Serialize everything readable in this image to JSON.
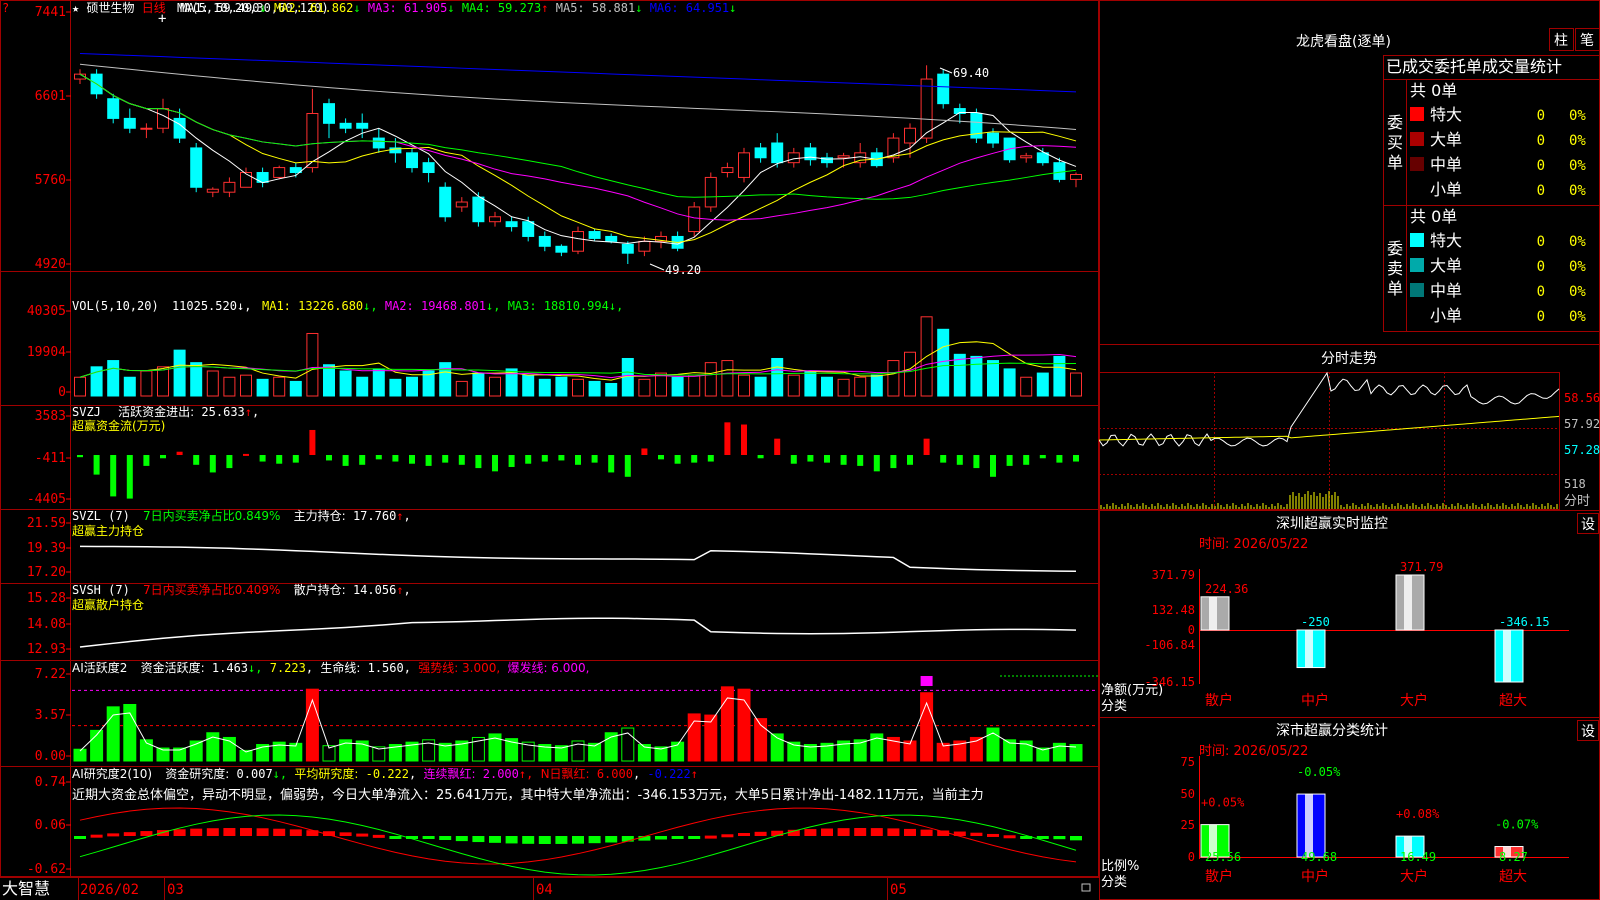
{
  "app": {
    "brand": "大智慧",
    "star": "★",
    "stock_name": "硕世生物",
    "period": "日线",
    "tag": "?"
  },
  "panels": {
    "main": {
      "ma_spec": "MA(5,10,20,30,60,120)",
      "ma": [
        {
          "name": "MA1:",
          "value": "59.490",
          "dir": "↓",
          "color": "#ffffff"
        },
        {
          "name": "MA2:",
          "value": "61.862",
          "dir": "↓",
          "color": "#ffff00"
        },
        {
          "name": "MA3:",
          "value": "61.905",
          "dir": "↓",
          "color": "#ff00ff"
        },
        {
          "name": "MA4:",
          "value": "59.273",
          "dir": "↑",
          "color": "#00ff00"
        },
        {
          "name": "MA5:",
          "value": "58.881",
          "dir": "↓",
          "color": "#c0c0c0"
        },
        {
          "name": "MA6:",
          "value": "64.951",
          "dir": "↓",
          "color": "#0000ff"
        }
      ],
      "yticks": [
        "7441",
        "6601",
        "5760",
        "4920"
      ],
      "hi_label": "69.40",
      "lo_label": "49.20"
    },
    "vol": {
      "spec": "VOL(5,10,20)",
      "value": "11025.520",
      "ma": [
        {
          "name": "MA1:",
          "value": "13226.680",
          "dir": "↓",
          "color": "#ffff00"
        },
        {
          "name": "MA2:",
          "value": "19468.801",
          "dir": "↓",
          "color": "#ff00ff"
        },
        {
          "name": "MA3:",
          "value": "18810.994",
          "dir": "↓",
          "color": "#00ff00"
        }
      ],
      "yticks": [
        "40305",
        "19904",
        "0"
      ]
    },
    "svzj": {
      "name": "SVZJ",
      "label": "活跃资金进出:",
      "value": "25.633",
      "dir": "↑",
      "sub": "超赢资金流(万元)",
      "yticks": [
        "3583",
        "-411",
        "-4405"
      ]
    },
    "svzl": {
      "name": "SVZL (7)",
      "label": "7日内买卖净占比0.849%",
      "label2": "主力持仓:",
      "value": "17.760",
      "dir": "↑",
      "sub": "超赢主力持仓",
      "yticks": [
        "21.59",
        "19.39",
        "17.20"
      ]
    },
    "svsh": {
      "name": "SVSH (7)",
      "label": "7日内买卖净占比0.409%",
      "label2": "散户持仓:",
      "value": "14.056",
      "dir": "↑",
      "sub": "超赢散户持仓",
      "yticks": [
        "15.28",
        "14.08",
        "12.93"
      ]
    },
    "ai1": {
      "name": "AI活跃度2",
      "label": "资金活跃度:",
      "v1": "1.463",
      "v2": "7.223",
      "label3": "生命线:",
      "v3": "1.560",
      "strong": "强势线: 3.000,",
      "burst": "爆发线: 6.000,",
      "yticks": [
        "7.22",
        "3.57",
        "0.00"
      ]
    },
    "ai2": {
      "name": "AI研究度2(10)",
      "label": "资金研究度:",
      "v1": "0.007",
      "label2": "平均研究度:",
      "v2": "-0.222",
      "label3": "连续飘红:",
      "v3": "2.000",
      "label4": "N日飘红:",
      "v4": "6.000",
      "v5": "-0.222",
      "text": "近期大资金总体偏空，异动不明显，偏弱势，今日大单净流入：25.641万元，其中特大单净流出：-346.153万元，大单5日累计净出-1482.11万元，当前主力",
      "yticks": [
        "0.74",
        "0.06",
        "-0.62"
      ]
    }
  },
  "xaxis": {
    "labels": [
      "2026/02",
      "03",
      "04",
      "05"
    ]
  },
  "right": {
    "lhb": {
      "title": "龙虎看盘(逐单)",
      "btn_zhu": "柱",
      "btn_bi": "笔",
      "header": "已成交委托单成交量统计",
      "buy_label": "委买单",
      "sell_label": "委卖单",
      "buy_total": "共 0单",
      "sell_total": "共 0单",
      "rows_buy": [
        {
          "name": "特大",
          "n": "0",
          "pct": "0%",
          "color": "#ff0000"
        },
        {
          "name": "大单",
          "n": "0",
          "pct": "0%",
          "color": "#aa0000"
        },
        {
          "name": "中单",
          "n": "0",
          "pct": "0%",
          "color": "#660000"
        },
        {
          "name": "小单",
          "n": "0",
          "pct": "0%",
          "color": "#000000"
        }
      ],
      "rows_sell": [
        {
          "name": "特大",
          "n": "0",
          "pct": "0%",
          "color": "#00ffff"
        },
        {
          "name": "大单",
          "n": "0",
          "pct": "0%",
          "color": "#00aaaa"
        },
        {
          "name": "中单",
          "n": "0",
          "pct": "0%",
          "color": "#007777"
        },
        {
          "name": "小单",
          "n": "0",
          "pct": "0%",
          "color": "#000000"
        }
      ]
    },
    "intraday": {
      "title": "分时走势",
      "yticks": [
        "58.56",
        "57.92",
        "57.28"
      ],
      "vol_tick": "518",
      "vol_unit": "分时"
    },
    "szmon": {
      "title": "深圳超赢实时监控",
      "setting": "设",
      "time": "时间: 2026/05/22",
      "ylabel": "净额(万元)",
      "xlabel": "分类",
      "yticks": [
        "371.79",
        "132.48",
        "0",
        "-106.84",
        "-346.15"
      ],
      "cats": [
        "散户",
        "中户",
        "大户",
        "超大"
      ],
      "values": [
        224.36,
        -250,
        371.79,
        -346.15
      ],
      "labels": [
        "224.36",
        "-250",
        "371.79",
        "-346.15"
      ]
    },
    "szcls": {
      "title": "深市超赢分类统计",
      "setting": "设",
      "time": "时间: 2026/05/22",
      "ylabel": "比例%",
      "xlabel": "分类",
      "yticks": [
        "75",
        "50",
        "25",
        "0"
      ],
      "cats": [
        "散户",
        "中户",
        "大户",
        "超大"
      ],
      "values": [
        25.56,
        49.68,
        16.49,
        8.27
      ],
      "chg": [
        "+0.05%",
        "-0.05%",
        "+0.08%",
        "-0.07%"
      ],
      "labels": [
        "25.56",
        "49.68",
        "16.49",
        "8.27"
      ]
    }
  },
  "chart_data": [
    {
      "type": "candlestick",
      "title": "硕世生物 日线",
      "ylim": [
        49.2,
        74.41
      ],
      "ohlc": [
        [
          68,
          69,
          67.5,
          68.5
        ],
        [
          68.5,
          69,
          66,
          66.5
        ],
        [
          66,
          66.5,
          63.5,
          64
        ],
        [
          64,
          65,
          62.5,
          63
        ],
        [
          63,
          63.5,
          62,
          63
        ],
        [
          63,
          66,
          62.5,
          65
        ],
        [
          64,
          65,
          61.5,
          62
        ],
        [
          61,
          61.5,
          56.5,
          57
        ],
        [
          56.5,
          57,
          56,
          56.8
        ],
        [
          56.5,
          58,
          56,
          57.5
        ],
        [
          57,
          59,
          57,
          58.5
        ],
        [
          58.5,
          59,
          57,
          57.5
        ],
        [
          58,
          59.2,
          57.8,
          59
        ],
        [
          59,
          59.5,
          58,
          58.5
        ],
        [
          59,
          67,
          58.5,
          64.5
        ],
        [
          65.5,
          66,
          62,
          63.5
        ],
        [
          63.5,
          64,
          62.5,
          63
        ],
        [
          63.5,
          64.5,
          62,
          63
        ],
        [
          62,
          63,
          60.5,
          61
        ],
        [
          61,
          62,
          59.5,
          60.5
        ],
        [
          60.5,
          61,
          58.5,
          59
        ],
        [
          59.5,
          60,
          57.5,
          58.5
        ],
        [
          57,
          57.5,
          53.5,
          54
        ],
        [
          55,
          56,
          54.5,
          55.5
        ],
        [
          56,
          56.5,
          53,
          53.5
        ],
        [
          53.5,
          54.5,
          53,
          54
        ],
        [
          53.5,
          54,
          52.5,
          53
        ],
        [
          53.5,
          54,
          51.5,
          52
        ],
        [
          52,
          52.5,
          50.5,
          51
        ],
        [
          51,
          51.2,
          50,
          50.4
        ],
        [
          50.5,
          53,
          50.2,
          52.5
        ],
        [
          52.5,
          52.8,
          51.5,
          51.8
        ],
        [
          52,
          52.3,
          51.3,
          51.5
        ],
        [
          51.2,
          51.5,
          49.2,
          50.3
        ],
        [
          50.5,
          52,
          50,
          51.5
        ],
        [
          51.5,
          52.5,
          50.8,
          52
        ],
        [
          52,
          52.5,
          50.5,
          50.8
        ],
        [
          52.5,
          55.5,
          52,
          55
        ],
        [
          55,
          58.5,
          54.5,
          58
        ],
        [
          58.5,
          59.5,
          58,
          59
        ],
        [
          58,
          61,
          57.5,
          60.5
        ],
        [
          61,
          61.5,
          59.5,
          60
        ],
        [
          61.5,
          62.5,
          59,
          59.5
        ],
        [
          59.5,
          61,
          59,
          60.5
        ],
        [
          61,
          61.5,
          59.2,
          59.8
        ],
        [
          60,
          60.5,
          59,
          59.5
        ],
        [
          60,
          60.5,
          59,
          60.2
        ],
        [
          59.5,
          61.5,
          59,
          60.5
        ],
        [
          60.5,
          61,
          59,
          59.2
        ],
        [
          60,
          62.5,
          59.5,
          62
        ],
        [
          61.5,
          63.5,
          60,
          63
        ],
        [
          62,
          69.4,
          61.5,
          68
        ],
        [
          68.5,
          69,
          65,
          65.5
        ],
        [
          65,
          65.5,
          63.5,
          64.5
        ],
        [
          64.5,
          65,
          61.5,
          62
        ],
        [
          62.5,
          63,
          61,
          61.5
        ],
        [
          62,
          62,
          59.5,
          59.8
        ],
        [
          60,
          60.5,
          59.5,
          60.2
        ],
        [
          60.5,
          61,
          59.2,
          59.5
        ],
        [
          59.5,
          60,
          57.5,
          57.8
        ],
        [
          57.8,
          58.5,
          57,
          58.3
        ]
      ]
    },
    {
      "type": "bar",
      "title": "VOL(5,10,20)",
      "ylim": [
        0,
        40305
      ],
      "values": [
        9000,
        14000,
        17000,
        9000,
        12000,
        14000,
        22000,
        16000,
        12000,
        9000,
        10000,
        8000,
        9000,
        7000,
        30000,
        15000,
        12000,
        9000,
        13000,
        8000,
        9000,
        12000,
        16000,
        7000,
        11000,
        9000,
        13000,
        10000,
        8000,
        9000,
        8000,
        7000,
        6000,
        18000,
        8000,
        11000,
        9000,
        10000,
        16000,
        17000,
        10000,
        9000,
        18000,
        10000,
        12000,
        9000,
        8000,
        9000,
        10000,
        17000,
        21000,
        38000,
        32000,
        20000,
        19000,
        17000,
        13000,
        9000,
        11000,
        19000,
        11025
      ]
    },
    {
      "type": "bar",
      "title": "SVZJ 活跃资金进出",
      "ylim": [
        -4405,
        3583
      ],
      "values": [
        -200,
        -1800,
        -3800,
        -4000,
        -1000,
        -300,
        300,
        -900,
        -1600,
        -1200,
        100,
        -600,
        -800,
        -700,
        2300,
        -500,
        -1000,
        -900,
        -400,
        -600,
        -800,
        -1000,
        -700,
        -900,
        -1200,
        -1500,
        -1100,
        -800,
        -600,
        -500,
        -900,
        -700,
        -1600,
        -2000,
        600,
        -400,
        -800,
        -700,
        -600,
        3000,
        2800,
        -300,
        1500,
        -800,
        -600,
        -700,
        -900,
        -1000,
        -1500,
        -1200,
        -900,
        1500,
        -700,
        -900,
        -1200,
        -2000,
        -1000,
        -900,
        -300,
        -700,
        -600
      ]
    },
    {
      "type": "line",
      "title": "SVZL 主力持仓",
      "ylim": [
        17.2,
        21.59
      ]
    },
    {
      "type": "line",
      "title": "SVSH 散户持仓",
      "ylim": [
        12.93,
        15.28
      ]
    },
    {
      "type": "bar",
      "title": "AI活跃度2",
      "ylim": [
        0,
        7.22
      ]
    },
    {
      "type": "bar",
      "title": "AI研究度2(10)",
      "ylim": [
        -0.62,
        0.74
      ]
    }
  ]
}
